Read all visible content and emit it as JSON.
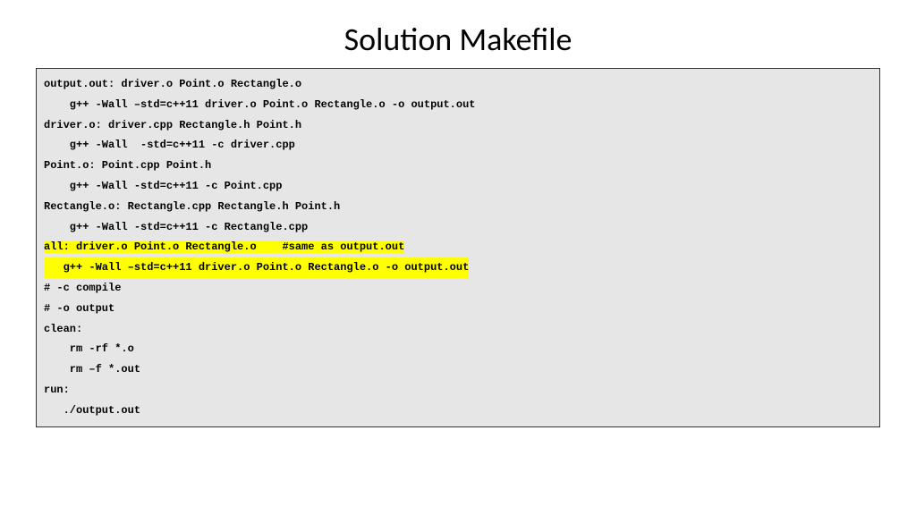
{
  "title": "Solution Makefile",
  "code": {
    "l1": "output.out: driver.o Point.o Rectangle.o",
    "l2": "    g++ -Wall –std=c++11 driver.o Point.o Rectangle.o -o output.out",
    "l3": "",
    "l4": "driver.o: driver.cpp Rectangle.h Point.h",
    "l5": "    g++ -Wall  -std=c++11 -c driver.cpp",
    "l6": "",
    "l7": "Point.o: Point.cpp Point.h",
    "l8": "    g++ -Wall -std=c++11 -c Point.cpp",
    "l9": "",
    "l10": "Rectangle.o: Rectangle.cpp Rectangle.h Point.h",
    "l11": "    g++ -Wall -std=c++11 -c Rectangle.cpp",
    "l12": "",
    "l13": "all: driver.o Point.o Rectangle.o    #same as output.out",
    "l14": "   g++ -Wall –std=c++11 driver.o Point.o Rectangle.o -o output.out",
    "l15": "",
    "l16": "# -c compile",
    "l17": "# -o output",
    "l18": "clean:",
    "l19": "    rm -rf *.o",
    "l20": "    rm –f *.out",
    "l21": "",
    "l22": "run:",
    "l23": "   ./output.out"
  }
}
